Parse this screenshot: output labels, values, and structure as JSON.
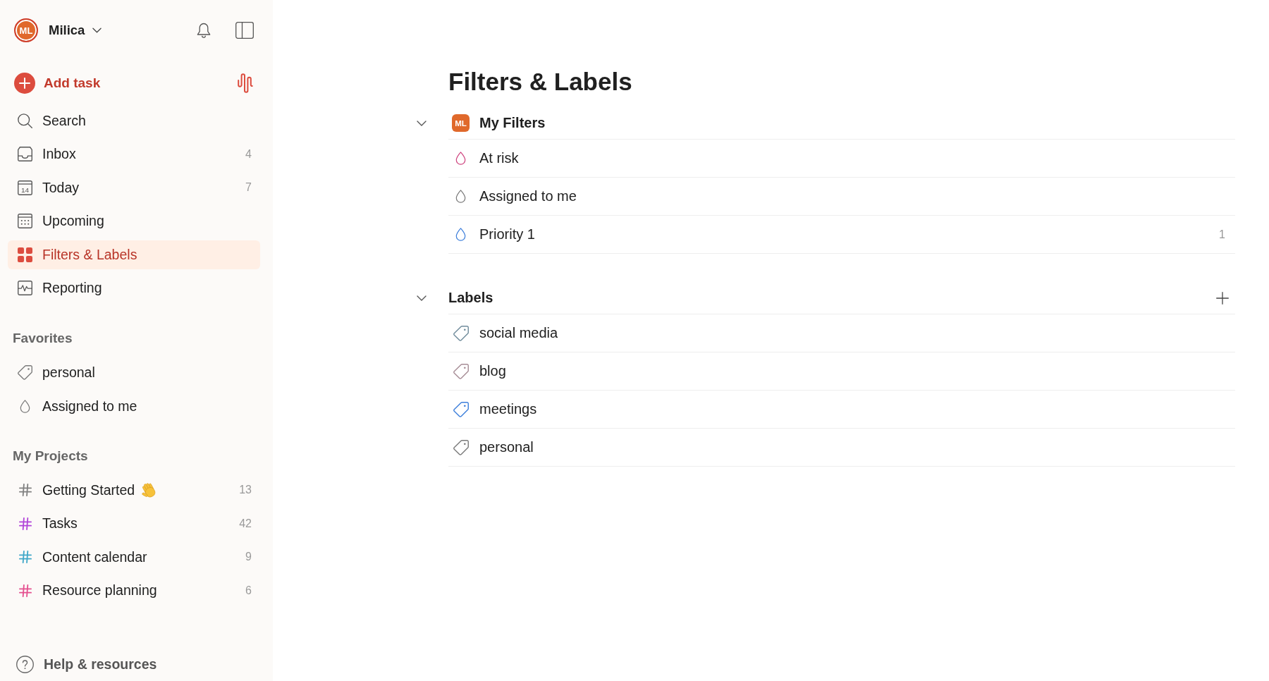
{
  "sidebar": {
    "user": {
      "initials": "ML",
      "name": "Milica"
    },
    "add_task": {
      "label": "Add task"
    },
    "nav": [
      {
        "label": "Search",
        "kind": "search",
        "selected": false
      },
      {
        "label": "Inbox",
        "kind": "inbox",
        "count": "4",
        "selected": false
      },
      {
        "label": "Today",
        "kind": "today",
        "icon_text": "14",
        "count": "7",
        "selected": false
      },
      {
        "label": "Upcoming",
        "kind": "upcoming",
        "selected": false
      },
      {
        "label": "Filters & Labels",
        "kind": "filters",
        "selected": true
      },
      {
        "label": "Reporting",
        "kind": "reporting",
        "selected": false
      }
    ],
    "favorites": {
      "title": "Favorites",
      "items": [
        {
          "label": "personal",
          "kind": "label",
          "color": "#7a7a7a",
          "selected": false
        },
        {
          "label": "Assigned to me",
          "kind": "filter",
          "color": "#7a7a7a",
          "selected": false
        }
      ]
    },
    "projects": {
      "title": "My Projects",
      "items": [
        {
          "name": "Getting Started",
          "emoji_icon": true,
          "count": "13",
          "color": "#808080",
          "selected": false
        },
        {
          "name": "Tasks",
          "count": "42",
          "color": "#b145d9",
          "selected": false
        },
        {
          "name": "Content calendar",
          "count": "9",
          "color": "#3fa7c8",
          "selected": false
        },
        {
          "name": "Resource planning",
          "count": "6",
          "color": "#e4508f",
          "selected": false
        }
      ]
    },
    "help": {
      "label": "Help & resources"
    }
  },
  "main": {
    "title": "Filters & Labels",
    "sections": [
      {
        "kind": "filters",
        "title": "My Filters",
        "badge": "ML",
        "expanded": true,
        "items": [
          {
            "name": "At risk",
            "color": "#cf447f"
          },
          {
            "name": "Assigned to me",
            "color": "#7a7a7a"
          },
          {
            "name": "Priority 1",
            "color": "#3d7fdb",
            "count": "1"
          }
        ]
      },
      {
        "kind": "labels",
        "title": "Labels",
        "expanded": true,
        "add_button": true,
        "items": [
          {
            "name": "social media",
            "color": "#6f8b9b"
          },
          {
            "name": "blog",
            "color": "#a68c95"
          },
          {
            "name": "meetings",
            "color": "#3d7fdb"
          },
          {
            "name": "personal",
            "color": "#7a7a7a"
          }
        ]
      }
    ]
  }
}
